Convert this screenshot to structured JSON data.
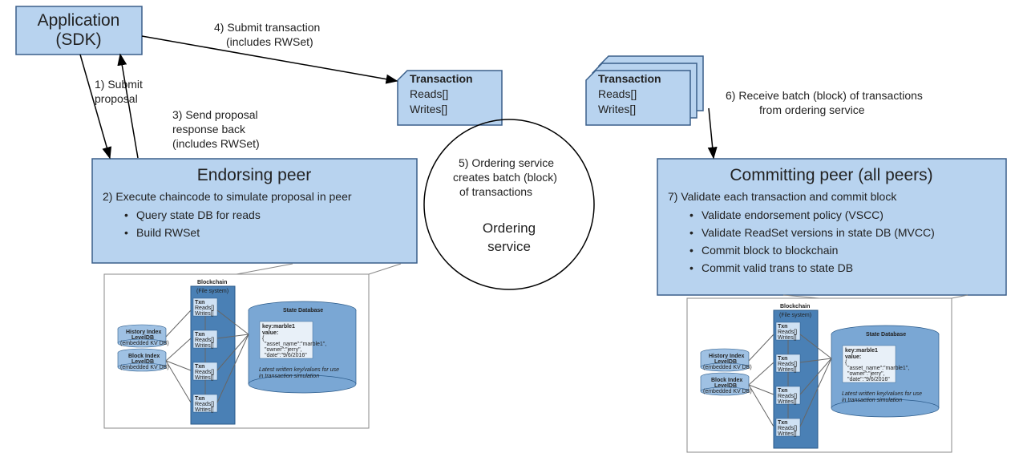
{
  "app_box": {
    "line1": "Application",
    "line2": "(SDK)"
  },
  "endorsing_box": {
    "title": "Endorsing peer",
    "line1": "2) Execute chaincode to simulate proposal in peer",
    "bullet1": "Query state DB for reads",
    "bullet2": "Build RWSet"
  },
  "committing_box": {
    "title": "Committing peer (all peers)",
    "line1": "7) Validate each transaction and commit block",
    "bullet1": "Validate endorsement policy (VSCC)",
    "bullet2": "Validate ReadSet versions in state DB (MVCC)",
    "bullet3": "Commit block to blockchain",
    "bullet4": "Commit valid trans to state DB"
  },
  "txn_card": {
    "title": "Transaction",
    "reads": "Reads[]",
    "writes": "Writes[]"
  },
  "ordering_circle": {
    "msg1": "5) Ordering service",
    "msg2": "creates batch (block)",
    "msg3": "of transactions",
    "name1": "Ordering",
    "name2": "service"
  },
  "arrow1": {
    "a": "1) Submit",
    "b": "proposal"
  },
  "arrow3": {
    "a": "3) Send proposal",
    "b": "response back",
    "c": "(includes RWSet)"
  },
  "arrow4": {
    "a": "4) Submit transaction",
    "b": "(includes RWSet)"
  },
  "arrow6": {
    "a": "6) Receive batch (block) of transactions",
    "b": "from ordering service"
  },
  "inset": {
    "bc_title1": "Blockchain",
    "bc_title2": "(File system)",
    "idx1a": "History Index",
    "idx1b": "LevelDB",
    "idx1c": "(embedded KV DB)",
    "idx2a": "Block Index",
    "idx2b": "LevelDB",
    "idx2c": "(embedded KV DB)",
    "state_title": "State Database",
    "state_k": "key:marble1",
    "state_v": "value:",
    "state_j1": "{",
    "state_j2": "\"asset_name\":\"marble1\",",
    "state_j3": "\"owner\":\"jerry\",",
    "state_j4": "\"date\":\"9/6/2016\"",
    "state_j5": "}",
    "state_note1": "Latest written key/values for use",
    "state_note2": "in transaction simulation",
    "txn_t": "Txn",
    "txn_r": "Reads[]",
    "txn_w": "Writes[]"
  }
}
